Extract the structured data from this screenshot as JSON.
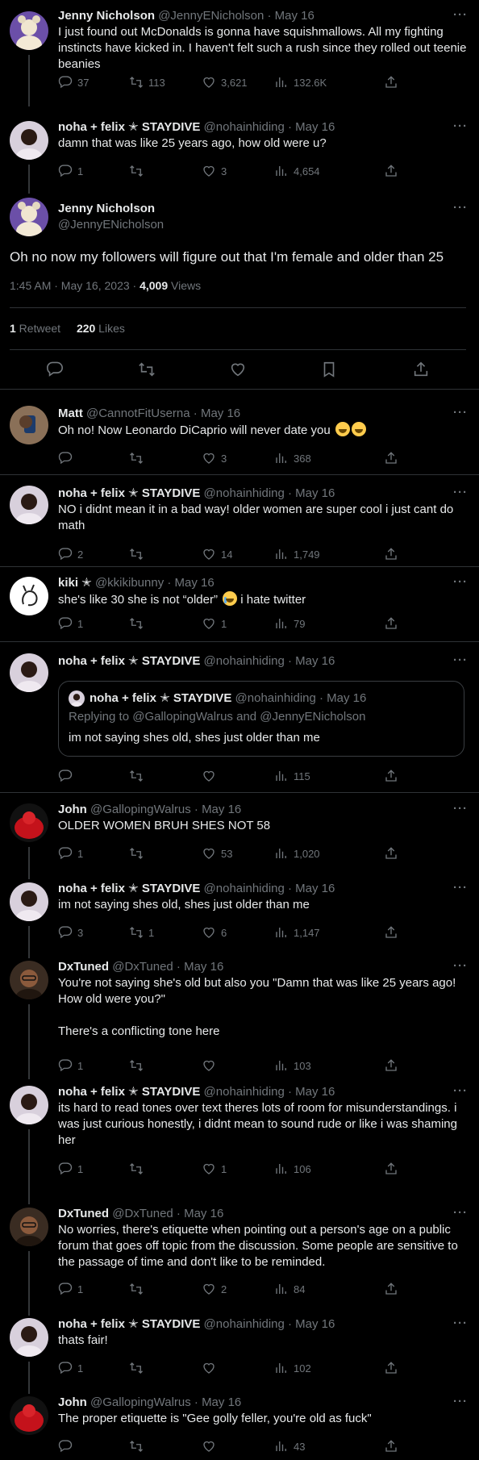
{
  "colors": {
    "background": "#000000",
    "text": "#e7e9ea",
    "muted": "#71767b",
    "divider": "#2f3336"
  },
  "icons": {
    "reply": "reply-icon",
    "retweet": "retweet-icon",
    "like": "heart-icon",
    "views": "views-icon",
    "share": "share-icon",
    "bookmark": "bookmark-icon",
    "more": "more-icon"
  },
  "tweets": [
    {
      "name": "Jenny Nicholson",
      "handle": "@JennyENicholson · May 16",
      "text": "I just found out McDonalds is gonna have squishmallows. All my fighting instincts have kicked in. I haven't felt such a rush since they rolled out teenie beanies",
      "replies": "37",
      "retweets": "113",
      "likes": "3,621",
      "views": "132.6K"
    },
    {
      "name": "noha + felix ✭ STAYDIVE",
      "handle": "@nohainhiding · May 16",
      "text": "damn that was like 25 years ago, how old were u?",
      "replies": "1",
      "retweets": "",
      "likes": "3",
      "views": "4,654"
    }
  ],
  "main": {
    "name": "Jenny Nicholson",
    "handle": "@JennyENicholson",
    "text": "Oh no now my followers will figure out that I'm female and older than 25",
    "time": "1:45 AM · May 16, 2023 · ",
    "views_count": "4,009",
    "views_label": " Views",
    "retweets_count": "1",
    "retweets_label": " Retweet",
    "likes_count": "220",
    "likes_label": " Likes"
  },
  "replies": [
    {
      "name": "Matt",
      "handle": "@CannotFitUserna · May 16",
      "text": "Oh no! Now Leonardo DiCaprio will never date you",
      "replies": "",
      "retweets": "",
      "likes": "3",
      "views": "368"
    },
    {
      "name": "noha + felix ✭ STAYDIVE",
      "handle": "@nohainhiding · May 16",
      "text": "NO i didnt mean it in a bad way! older women are super cool i just cant do math",
      "replies": "2",
      "retweets": "",
      "likes": "14",
      "views": "1,749"
    },
    {
      "name": "kiki ✭",
      "handle": "@kkikibunny · May 16",
      "text": "she's like 30 she is not “older”",
      "text2": " i hate twitter",
      "replies": "1",
      "retweets": "",
      "likes": "1",
      "views": "79"
    },
    {
      "name": "noha + felix ✭ STAYDIVE",
      "handle": "@nohainhiding · May 16",
      "replies": "",
      "retweets": "",
      "likes": "",
      "views": "115",
      "quote": {
        "name": "noha + felix ✭ STAYDIVE",
        "handle": "@nohainhiding · May 16",
        "replying": "Replying to @GallopingWalrus and @JennyENicholson",
        "text": "im not saying shes old, shes just older than me"
      }
    },
    {
      "name": "John",
      "handle": "@GallopingWalrus · May 16",
      "text": "OLDER WOMEN BRUH SHES NOT 58",
      "replies": "1",
      "retweets": "",
      "likes": "53",
      "views": "1,020"
    },
    {
      "name": "noha + felix ✭ STAYDIVE",
      "handle": "@nohainhiding · May 16",
      "text": "im not saying shes old, shes just older than me",
      "replies": "3",
      "retweets": "1",
      "likes": "6",
      "views": "1,147"
    },
    {
      "name": "DxTuned",
      "handle": "@DxTuned · May 16",
      "text": "You're not saying she's old but also you \"Damn that was like 25 years ago! How old were you?\"\n\nThere's a conflicting tone here",
      "replies": "1",
      "retweets": "",
      "likes": "",
      "views": "103"
    },
    {
      "name": "noha + felix ✭ STAYDIVE",
      "handle": "@nohainhiding · May 16",
      "text": "its hard to read tones over text theres lots of room for misunderstandings. i was just curious honestly, i didnt mean to sound rude or like i was shaming her",
      "replies": "1",
      "retweets": "",
      "likes": "1",
      "views": "106"
    },
    {
      "name": "DxTuned",
      "handle": "@DxTuned · May 16",
      "text": "No worries, there's etiquette when pointing out a person's age on a public forum that goes off topic from the discussion. Some people are sensitive to the passage of time and don't like to be reminded.",
      "replies": "1",
      "retweets": "",
      "likes": "2",
      "views": "84"
    },
    {
      "name": "noha + felix ✭ STAYDIVE",
      "handle": "@nohainhiding · May 16",
      "text": "thats fair!",
      "replies": "1",
      "retweets": "",
      "likes": "",
      "views": "102"
    },
    {
      "name": "John",
      "handle": "@GallopingWalrus · May 16",
      "text": "The proper etiquette is \"Gee golly feller, you're old as fuck\"",
      "replies": "",
      "retweets": "",
      "likes": "",
      "views": "43"
    }
  ]
}
